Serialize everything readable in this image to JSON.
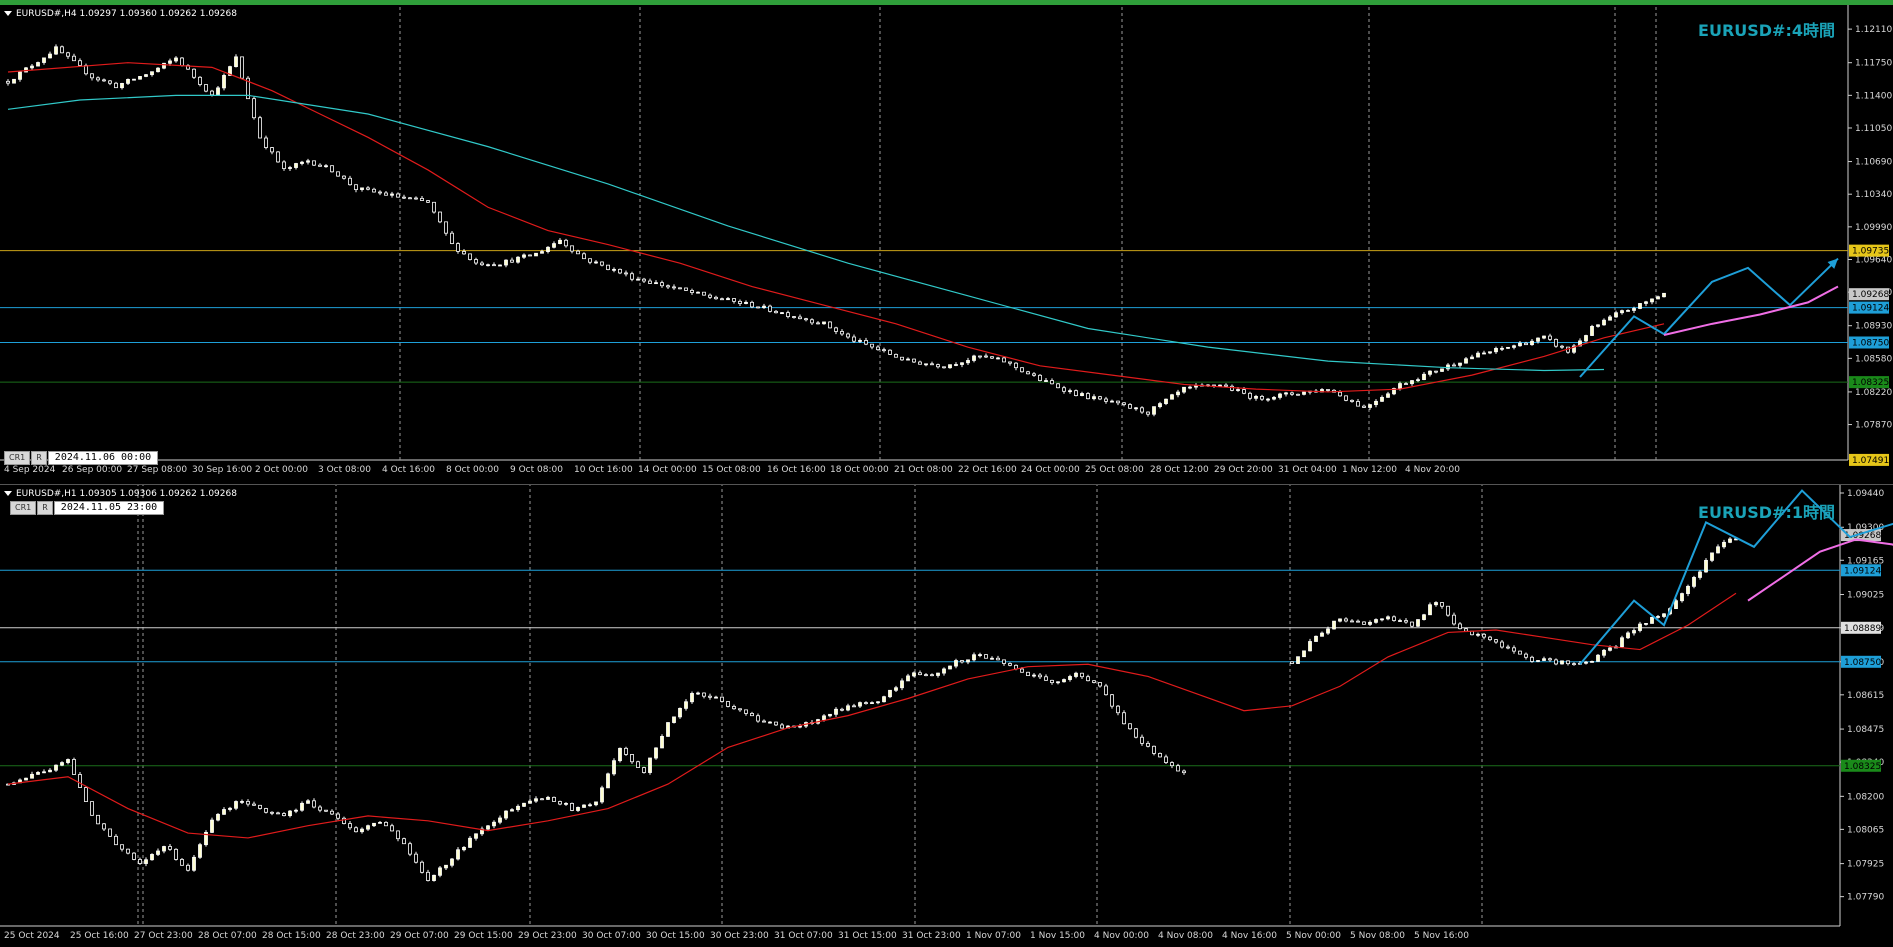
{
  "chart_data": [
    {
      "type": "candlestick",
      "panel": "H4",
      "symbol_line": "EURUSD#,H4  1.09297 1.09360 1.09262 1.09268",
      "watermark": "EURUSD#:4時間",
      "tool_buttons": [
        "CR1",
        "R"
      ],
      "crosshair_time": "2024.11.06 00:00",
      "ylim": [
        1.0749,
        1.1224
      ],
      "yticks": [
        "1.12110",
        "1.11750",
        "1.11400",
        "1.11050",
        "1.10690",
        "1.10340",
        "1.09990",
        "1.09640",
        "1.09290",
        "1.08930",
        "1.08580",
        "1.08220",
        "1.07870"
      ],
      "price_labels": [
        {
          "text": "1.09735",
          "value": 1.09735,
          "color": "#e6c619"
        },
        {
          "text": "1.09268",
          "value": 1.09268,
          "color": "#c8c8c8"
        },
        {
          "text": "1.09124",
          "value": 1.09124,
          "color": "#1e9fd8"
        },
        {
          "text": "1.08750",
          "value": 1.0875,
          "color": "#1e9fd8"
        },
        {
          "text": "1.08325",
          "value": 1.08325,
          "color": "#1a8a1a"
        },
        {
          "text": "1.07491",
          "value": 1.07491,
          "color": "#e6c619"
        }
      ],
      "hlines": [
        {
          "value": 1.09735,
          "color": "#c9a318"
        },
        {
          "value": 1.09124,
          "color": "#1e9fd8"
        },
        {
          "value": 1.0875,
          "color": "#1e9fd8"
        },
        {
          "value": 1.08325,
          "color": "#1a6e1a"
        }
      ],
      "xticks": [
        "4 Sep 2024",
        "26 Sep 00:00",
        "27 Sep 08:00",
        "30 Sep 16:00",
        "2 Oct 00:00",
        "3 Oct 08:00",
        "4 Oct 16:00",
        "8 Oct 00:00",
        "9 Oct 08:00",
        "10 Oct 16:00",
        "14 Oct 00:00",
        "15 Oct 08:00",
        "16 Oct 16:00",
        "18 Oct 00:00",
        "21 Oct 08:00",
        "22 Oct 16:00",
        "24 Oct 00:00",
        "25 Oct 08:00",
        "28 Oct 12:00",
        "29 Oct 20:00",
        "31 Oct 04:00",
        "1 Nov 12:00",
        "4 Nov 20:00"
      ],
      "n_candles": 215,
      "close_path": [
        [
          0,
          1.1155
        ],
        [
          8,
          1.119
        ],
        [
          14,
          1.116
        ],
        [
          18,
          1.115
        ],
        [
          24,
          1.1165
        ],
        [
          28,
          1.118
        ],
        [
          34,
          1.114
        ],
        [
          38,
          1.118
        ],
        [
          42,
          1.1095
        ],
        [
          46,
          1.106
        ],
        [
          50,
          1.107
        ],
        [
          54,
          1.106
        ],
        [
          58,
          1.104
        ],
        [
          62,
          1.1035
        ],
        [
          66,
          1.103
        ],
        [
          70,
          1.1025
        ],
        [
          74,
          1.098
        ],
        [
          78,
          1.096
        ],
        [
          82,
          1.096
        ],
        [
          88,
          1.097
        ],
        [
          92,
          1.0985
        ],
        [
          96,
          1.0965
        ],
        [
          100,
          1.0955
        ],
        [
          104,
          1.0945
        ],
        [
          110,
          1.0935
        ],
        [
          116,
          1.0925
        ],
        [
          124,
          1.0915
        ],
        [
          130,
          1.0905
        ],
        [
          136,
          1.0895
        ],
        [
          140,
          1.088
        ],
        [
          144,
          1.087
        ],
        [
          150,
          1.0855
        ],
        [
          156,
          1.085
        ],
        [
          162,
          1.086
        ],
        [
          166,
          1.0855
        ],
        [
          172,
          1.0835
        ],
        [
          178,
          1.082
        ],
        [
          184,
          1.081
        ],
        [
          190,
          1.08
        ],
        [
          196,
          1.0825
        ],
        [
          202,
          1.083
        ],
        [
          208,
          1.0815
        ],
        [
          214,
          1.082
        ],
        [
          220,
          1.0825
        ],
        [
          226,
          1.0805
        ],
        [
          232,
          1.083
        ],
        [
          238,
          1.0845
        ],
        [
          244,
          1.086
        ],
        [
          250,
          1.087
        ],
        [
          256,
          1.088
        ],
        [
          260,
          1.0865
        ],
        [
          264,
          1.089
        ],
        [
          268,
          1.0905
        ],
        [
          272,
          1.0915
        ],
        [
          276,
          1.0928
        ]
      ],
      "series": [
        {
          "name": "",
          "color": "#e01b1b",
          "path": [
            [
              0,
              1.1165
            ],
            [
              20,
              1.1175
            ],
            [
              34,
              1.117
            ],
            [
              44,
              1.1145
            ],
            [
              52,
              1.112
            ],
            [
              60,
              1.1095
            ],
            [
              70,
              1.106
            ],
            [
              80,
              1.102
            ],
            [
              90,
              1.0995
            ],
            [
              100,
              1.098
            ],
            [
              112,
              1.096
            ],
            [
              124,
              1.0935
            ],
            [
              136,
              1.0915
            ],
            [
              148,
              1.0895
            ],
            [
              160,
              1.087
            ],
            [
              172,
              1.085
            ],
            [
              184,
              1.084
            ],
            [
              196,
              1.083
            ],
            [
              208,
              1.0825
            ],
            [
              220,
              1.0822
            ],
            [
              232,
              1.0825
            ],
            [
              244,
              1.084
            ],
            [
              256,
              1.086
            ],
            [
              266,
              1.088
            ],
            [
              276,
              1.0895
            ]
          ]
        },
        {
          "name": "",
          "color": "#31c9c9",
          "path": [
            [
              0,
              1.1125
            ],
            [
              12,
              1.1135
            ],
            [
              28,
              1.114
            ],
            [
              40,
              1.114
            ],
            [
              60,
              1.112
            ],
            [
              80,
              1.1085
            ],
            [
              100,
              1.1045
            ],
            [
              120,
              1.1
            ],
            [
              140,
              1.096
            ],
            [
              160,
              1.0925
            ],
            [
              180,
              1.089
            ],
            [
              200,
              1.087
            ],
            [
              220,
              1.0855
            ],
            [
              240,
              1.0848
            ],
            [
              256,
              1.0845
            ],
            [
              266,
              1.0846
            ]
          ]
        }
      ],
      "annotation_wave": {
        "color": "#1e9fd8",
        "points": [
          [
            262,
            1.0838
          ],
          [
            271,
            1.0903
          ],
          [
            276,
            1.0884
          ],
          [
            284,
            1.094
          ],
          [
            290,
            1.0955
          ],
          [
            297,
            1.0915
          ],
          [
            305,
            1.0965
          ]
        ],
        "arrow": true
      },
      "annotation_curve": {
        "color": "#f06ee6",
        "points": [
          [
            276,
            1.0883
          ],
          [
            284,
            1.0895
          ],
          [
            292,
            1.0905
          ],
          [
            300,
            1.0918
          ],
          [
            305,
            1.0935
          ]
        ]
      }
    },
    {
      "type": "candlestick",
      "panel": "H1",
      "symbol_line": "EURUSD#,H1  1.09305 1.09306 1.09262 1.09268",
      "watermark": "EURUSD#:1時間",
      "tool_buttons": [
        "CR1",
        "R"
      ],
      "crosshair_time": "2024.11.05 23:00",
      "ylim": [
        1.0767,
        1.0944
      ],
      "yticks": [
        "1.09440",
        "1.09300",
        "1.09165",
        "1.09025",
        "1.08889",
        "1.08750",
        "1.08615",
        "1.08475",
        "1.08340",
        "1.08200",
        "1.08065",
        "1.07925",
        "1.07790"
      ],
      "price_labels": [
        {
          "text": "1.09268",
          "value": 1.09268,
          "color": "#c8c8c8"
        },
        {
          "text": "1.09124",
          "value": 1.09124,
          "color": "#1e9fd8"
        },
        {
          "text": "1.08889",
          "value": 1.08889,
          "color": "#e0e0e0"
        },
        {
          "text": "1.08750",
          "value": 1.0875,
          "color": "#1e9fd8"
        },
        {
          "text": "1.08325",
          "value": 1.08325,
          "color": "#1a8a1a"
        }
      ],
      "hlines": [
        {
          "value": 1.09124,
          "color": "#1e9fd8"
        },
        {
          "value": 1.08889,
          "color": "#d0d0d0"
        },
        {
          "value": 1.0875,
          "color": "#1e9fd8"
        },
        {
          "value": 1.08325,
          "color": "#1a6e1a"
        }
      ],
      "xticks": [
        "25 Oct 2024",
        "25 Oct 16:00",
        "27 Oct 23:00",
        "28 Oct 07:00",
        "28 Oct 15:00",
        "28 Oct 23:00",
        "29 Oct 07:00",
        "29 Oct 15:00",
        "29 Oct 23:00",
        "30 Oct 07:00",
        "30 Oct 15:00",
        "30 Oct 23:00",
        "31 Oct 07:00",
        "31 Oct 15:00",
        "31 Oct 23:00",
        "1 Nov 07:00",
        "1 Nov 15:00",
        "4 Nov 00:00",
        "4 Nov 08:00",
        "4 Nov 16:00",
        "5 Nov 00:00",
        "5 Nov 08:00",
        "5 Nov 16:00"
      ],
      "n_candles": 215,
      "close_path": [
        [
          0,
          1.0825
        ],
        [
          6,
          1.083
        ],
        [
          10,
          1.0835
        ],
        [
          14,
          1.0812
        ],
        [
          18,
          1.08
        ],
        [
          22,
          1.0793
        ],
        [
          26,
          1.08
        ],
        [
          30,
          1.079
        ],
        [
          34,
          1.081
        ],
        [
          38,
          1.0818
        ],
        [
          42,
          1.0815
        ],
        [
          46,
          1.0812
        ],
        [
          50,
          1.0818
        ],
        [
          54,
          1.0812
        ],
        [
          58,
          1.0806
        ],
        [
          62,
          1.081
        ],
        [
          66,
          1.08
        ],
        [
          70,
          1.0785
        ],
        [
          74,
          1.0795
        ],
        [
          78,
          1.0805
        ],
        [
          82,
          1.0812
        ],
        [
          86,
          1.0818
        ],
        [
          90,
          1.082
        ],
        [
          94,
          1.0815
        ],
        [
          98,
          1.0818
        ],
        [
          102,
          1.084
        ],
        [
          106,
          1.083
        ],
        [
          110,
          1.085
        ],
        [
          114,
          1.0862
        ],
        [
          118,
          1.086
        ],
        [
          122,
          1.0855
        ],
        [
          126,
          1.085
        ],
        [
          130,
          1.0848
        ],
        [
          134,
          1.085
        ],
        [
          138,
          1.0855
        ],
        [
          142,
          1.0858
        ],
        [
          146,
          1.086
        ],
        [
          150,
          1.087
        ],
        [
          154,
          1.087
        ],
        [
          158,
          1.0875
        ],
        [
          162,
          1.0878
        ],
        [
          166,
          1.0875
        ],
        [
          170,
          1.087
        ],
        [
          174,
          1.0866
        ],
        [
          178,
          1.087
        ],
        [
          182,
          1.0865
        ],
        [
          186,
          1.085
        ],
        [
          190,
          1.084
        ],
        [
          194,
          1.0832
        ],
        [
          196,
          1.083
        ]
      ],
      "gap_close_path": [
        [
          214,
          1.0875
        ],
        [
          218,
          1.0885
        ],
        [
          222,
          1.0893
        ],
        [
          226,
          1.089
        ],
        [
          230,
          1.0893
        ],
        [
          234,
          1.089
        ],
        [
          238,
          1.09
        ],
        [
          242,
          1.0888
        ],
        [
          246,
          1.0885
        ],
        [
          250,
          1.088
        ],
        [
          254,
          1.0876
        ],
        [
          258,
          1.0875
        ],
        [
          262,
          1.0874
        ],
        [
          264,
          1.0876
        ],
        [
          268,
          1.0882
        ],
        [
          272,
          1.089
        ],
        [
          276,
          1.0895
        ],
        [
          280,
          1.0905
        ],
        [
          284,
          1.092
        ],
        [
          288,
          1.0926
        ]
      ],
      "series": [
        {
          "name": "",
          "color": "#e01b1b",
          "path": [
            [
              0,
              1.0825
            ],
            [
              10,
              1.0828
            ],
            [
              20,
              1.0815
            ],
            [
              30,
              1.0805
            ],
            [
              40,
              1.0803
            ],
            [
              50,
              1.0808
            ],
            [
              60,
              1.0812
            ],
            [
              70,
              1.081
            ],
            [
              80,
              1.0806
            ],
            [
              90,
              1.081
            ],
            [
              100,
              1.0815
            ],
            [
              110,
              1.0825
            ],
            [
              120,
              1.084
            ],
            [
              130,
              1.0848
            ],
            [
              140,
              1.0853
            ],
            [
              150,
              1.086
            ],
            [
              160,
              1.0868
            ],
            [
              170,
              1.0873
            ],
            [
              180,
              1.0874
            ],
            [
              190,
              1.0869
            ],
            [
              198,
              1.0862
            ],
            [
              206,
              1.0855
            ],
            [
              214,
              1.0857
            ],
            [
              222,
              1.0865
            ],
            [
              230,
              1.0877
            ],
            [
              240,
              1.0887
            ],
            [
              248,
              1.0888
            ],
            [
              256,
              1.0885
            ],
            [
              264,
              1.0882
            ],
            [
              272,
              1.088
            ],
            [
              280,
              1.089
            ],
            [
              288,
              1.0903
            ]
          ]
        }
      ],
      "annotation_wave": {
        "color": "#1e9fd8",
        "points": [
          [
            262,
            1.0874
          ],
          [
            271,
            1.09
          ],
          [
            276,
            1.089
          ],
          [
            283,
            1.0932
          ],
          [
            291,
            1.0922
          ],
          [
            299,
            1.0945
          ],
          [
            307,
            1.0926
          ],
          [
            315,
            1.0932
          ],
          [
            322,
            1.0915
          ],
          [
            330,
            1.0925
          ],
          [
            337,
            1.0913
          ],
          [
            346,
            1.0947
          ]
        ],
        "arrow": true
      },
      "annotation_curve": {
        "color": "#f06ee6",
        "points": [
          [
            290,
            1.09
          ],
          [
            296,
            1.091
          ],
          [
            302,
            1.092
          ],
          [
            308,
            1.0925
          ],
          [
            314,
            1.0923
          ],
          [
            320,
            1.0918
          ],
          [
            326,
            1.0912
          ],
          [
            332,
            1.091
          ],
          [
            338,
            1.0912
          ],
          [
            344,
            1.092
          ]
        ]
      }
    }
  ]
}
